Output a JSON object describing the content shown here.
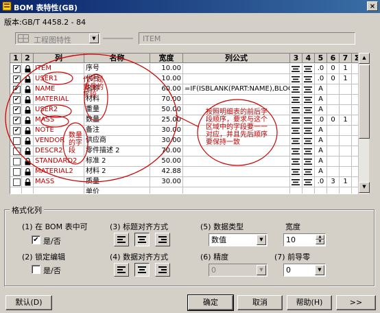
{
  "window": {
    "title": "BOM 表特性(GB)",
    "close_glyph": "×"
  },
  "version_label": "版本:GB/T 4458.2 - 84",
  "top_combo_left": "工程图特性",
  "top_combo_right": "ITEM",
  "grid": {
    "headers": [
      "1",
      "2",
      "列",
      "名称",
      "宽度",
      "列公式",
      "3",
      "4",
      "5",
      "6",
      "7",
      "Σ"
    ],
    "rows": [
      {
        "col": "ITEM",
        "name": "序号",
        "width": "10.00",
        "formula": "",
        "c1": true,
        "c5": ".0",
        "c6": "0",
        "c7": "1"
      },
      {
        "col": "USER1",
        "name": "代号",
        "width": "10.00",
        "formula": "",
        "c1": true,
        "c5": ".0",
        "c6": "0",
        "c7": "1"
      },
      {
        "col": "NAME",
        "name": "名称",
        "width": "60.00",
        "formula": "=IF(ISBLANK(PART:NAME),BLOCK",
        "c1": true,
        "c5": "A",
        "c6": "",
        "c7": ""
      },
      {
        "col": "MATERIAL",
        "name": "材料",
        "width": "70.00",
        "formula": "",
        "c1": true,
        "c5": "A",
        "c6": "",
        "c7": ""
      },
      {
        "col": "USER2",
        "name": "重量",
        "width": "50.00",
        "formula": "",
        "c1": true,
        "c5": "A",
        "c6": "",
        "c7": ""
      },
      {
        "col": "MASS",
        "name": "数量",
        "width": "25.00",
        "formula": "",
        "c1": true,
        "c5": ".0",
        "c6": "0",
        "c7": "1"
      },
      {
        "col": "NOTE",
        "name": "备注",
        "width": "30.00",
        "formula": "",
        "c1": true,
        "c5": "A",
        "c6": "",
        "c7": ""
      },
      {
        "col": "VENDOR",
        "name": "供应商",
        "width": "30.00",
        "formula": "",
        "c1": false,
        "c5": "A",
        "c6": "",
        "c7": ""
      },
      {
        "col": "DESCR2",
        "name": "零件描述 2",
        "width": "70.00",
        "formula": "",
        "c1": false,
        "c5": "A",
        "c6": "",
        "c7": ""
      },
      {
        "col": "STANDARD2",
        "name": "标准 2",
        "width": "50.00",
        "formula": "",
        "c1": false,
        "c5": "A",
        "c6": "",
        "c7": ""
      },
      {
        "col": "MATERIAL2",
        "name": "材料 2",
        "width": "42.88",
        "formula": "",
        "c1": false,
        "c5": "A",
        "c6": "",
        "c7": ""
      },
      {
        "col": "MASS",
        "name": "质量",
        "width": "30.00",
        "formula": "",
        "c1": false,
        "c5": ".0",
        "c6": "3",
        "c7": "1"
      },
      {
        "col": "",
        "name": "单价",
        "width": "",
        "formula": "",
        "c1": false,
        "c5": "",
        "c6": "",
        "c7": ""
      }
    ]
  },
  "annotations": {
    "code_fields": "代号是重量的字段",
    "qty_fields": "数量的字段",
    "order_note": "按照明细表的前后字段顺序，要求与这个区域中的字段要一一对应，并且先后顺序要保持一致"
  },
  "format": {
    "group_title": "格式化列",
    "opt1_label": "(1)  在 BOM 表中可",
    "opt1_check": "是/否",
    "opt2_label": "(2)  锁定编辑",
    "opt2_check": "是/否",
    "opt3_label": "(3)  标题对齐方式",
    "opt4_label": "(4)  数据对齐方式",
    "opt5_label": "(5)  数据类型",
    "opt5_value": "数值",
    "opt6_label": "(6)  精度",
    "opt6_value": "0",
    "opt7_label": "(7)  前导零",
    "opt7_value": "0",
    "width_label": "宽度",
    "width_value": "10"
  },
  "buttons": {
    "default": "默认(D)",
    "ok": "确定",
    "cancel": "取消",
    "help": "帮助(H)",
    "more": ">>"
  }
}
